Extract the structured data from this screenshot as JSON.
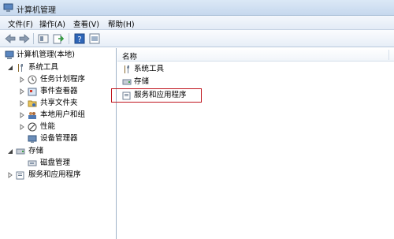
{
  "window": {
    "title": "计算机管理"
  },
  "menu": [
    {
      "label": "文件(F)"
    },
    {
      "label": "操作(A)"
    },
    {
      "label": "查看(V)"
    },
    {
      "label": "帮助(H)"
    }
  ],
  "toolbar": {
    "buttons": [
      "back-arrow-icon",
      "forward-arrow-icon",
      "up-folder-icon",
      "export-icon",
      "help-icon",
      "properties-icon"
    ]
  },
  "tree": {
    "root": "计算机管理(本地)",
    "system_tools": "系统工具",
    "task_scheduler": "任务计划程序",
    "event_viewer": "事件查看器",
    "shared_folders": "共享文件夹",
    "local_users": "本地用户和组",
    "performance": "性能",
    "device_manager": "设备管理器",
    "storage": "存储",
    "disk_management": "磁盘管理",
    "services_apps": "服务和应用程序"
  },
  "list": {
    "column_name": "名称",
    "items": [
      {
        "label": "系统工具",
        "icon": "tools-icon"
      },
      {
        "label": "存储",
        "icon": "storage-icon"
      },
      {
        "label": "服务和应用程序",
        "icon": "services-icon"
      }
    ]
  },
  "colors": {
    "highlight_border": "#c0161e",
    "titlebar": "#c6d8ee"
  }
}
